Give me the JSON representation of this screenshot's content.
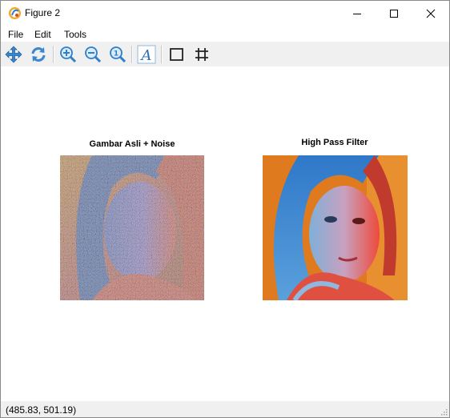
{
  "window": {
    "title": "Figure 2"
  },
  "menu": {
    "items": [
      "File",
      "Edit",
      "Tools"
    ]
  },
  "toolbar": {
    "tools": [
      "pan-icon",
      "reset-icon",
      "zoom-in-icon",
      "zoom-out-icon",
      "zoom-actual-icon",
      "text-icon",
      "rectangle-icon",
      "grid-icon"
    ]
  },
  "figure": {
    "subplots": [
      {
        "title": "Gambar Asli + Noise"
      },
      {
        "title": "High Pass Filter"
      }
    ]
  },
  "status": {
    "coordinates": "(485.83, 501.19)"
  },
  "colors": {
    "toolbar_bg": "#f0f0f0",
    "icon_blue": "#2f7fc9",
    "accent_orange": "#e07a1f"
  }
}
